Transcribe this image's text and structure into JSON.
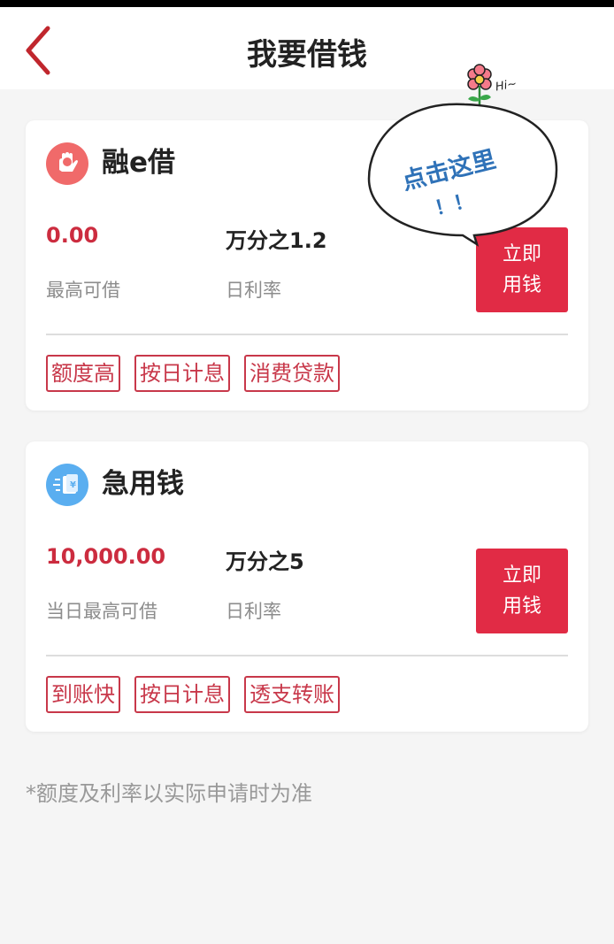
{
  "header": {
    "title": "我要借钱",
    "back_icon": "chevron-left-icon"
  },
  "products": [
    {
      "name": "融e借",
      "icon": "hand-coin-icon",
      "icon_color": "#f06a6a",
      "amount": "0.00",
      "amount_label": "最高可借",
      "rate": "万分之1.2",
      "rate_label": "日利率",
      "apply_label": "立即用钱",
      "tags": [
        "额度高",
        "按日计息",
        "消费贷款"
      ]
    },
    {
      "name": "急用钱",
      "icon": "money-notes-icon",
      "icon_color": "#5aaef0",
      "amount": "10,000.00",
      "amount_label": "当日最高可借",
      "rate": "万分之5",
      "rate_label": "日利率",
      "apply_label": "立即用钱",
      "tags": [
        "到账快",
        "按日计息",
        "透支转账"
      ]
    }
  ],
  "footnote": "*额度及利率以实际申请时为准",
  "bubble": {
    "text": "点击这里",
    "exclaim": "！！",
    "hi": "Hi~"
  },
  "colors": {
    "accent": "#e12b45",
    "tag": "#c8384a",
    "amount": "#cc2c3f"
  }
}
